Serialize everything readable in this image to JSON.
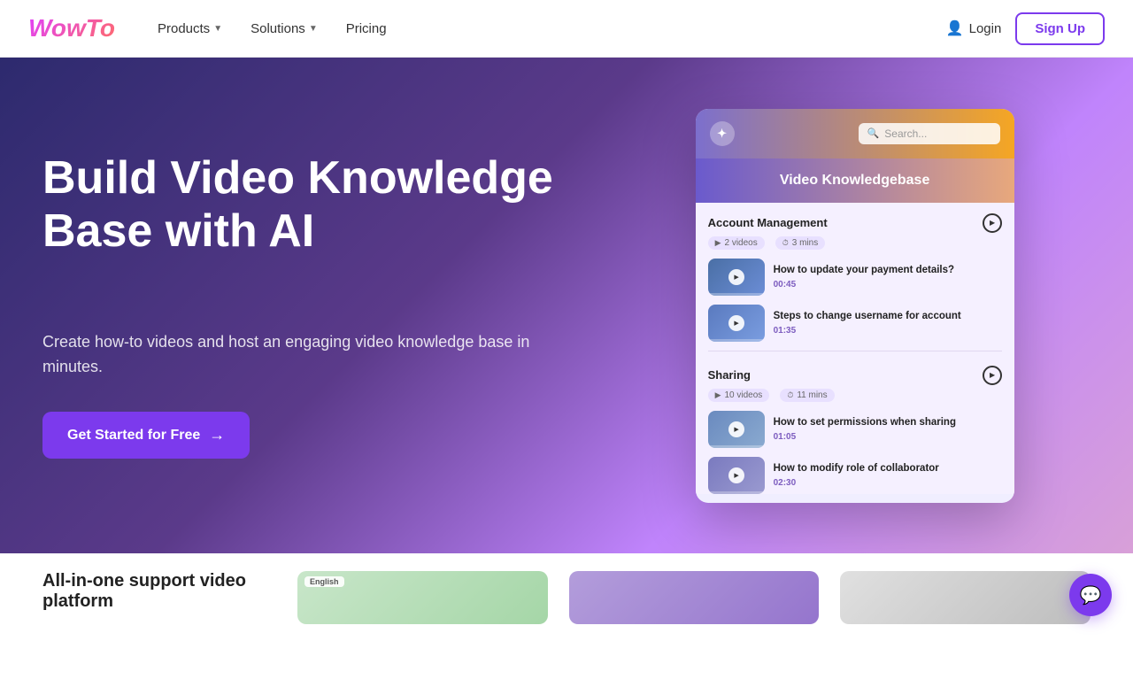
{
  "navbar": {
    "logo": "WowTo",
    "links": [
      {
        "label": "Products",
        "hasDropdown": true
      },
      {
        "label": "Solutions",
        "hasDropdown": true
      },
      {
        "label": "Pricing",
        "hasDropdown": false
      }
    ],
    "login_label": "Login",
    "signup_label": "Sign Up"
  },
  "hero": {
    "title": "Build Video Knowledge Base with AI",
    "subtitle": "Create how-to videos and host an engaging video knowledge base in minutes.",
    "cta_label": "Get Started for Free",
    "cta_arrow": "→"
  },
  "demo_widget": {
    "title": "Video Knowledgebase",
    "search_placeholder": "Search...",
    "sections": [
      {
        "title": "Account Management",
        "meta_videos": "2 videos",
        "meta_time": "3 mins",
        "videos": [
          {
            "title": "How to update your payment details?",
            "duration": "00:45"
          },
          {
            "title": "Steps to change username for account",
            "duration": "01:35"
          }
        ]
      },
      {
        "title": "Sharing",
        "meta_videos": "10 videos",
        "meta_time": "11 mins",
        "videos": [
          {
            "title": "How to set permissions when sharing",
            "duration": "01:05"
          },
          {
            "title": "How to modify role of collaborator",
            "duration": "02:30"
          }
        ]
      }
    ]
  },
  "bottom": {
    "title": "All-in-one support video platform",
    "cards": [
      {
        "lang": "English",
        "bg": "card-bg-1"
      },
      {
        "lang": "",
        "bg": "card-bg-2"
      },
      {
        "lang": "",
        "bg": "card-bg-3"
      }
    ]
  }
}
